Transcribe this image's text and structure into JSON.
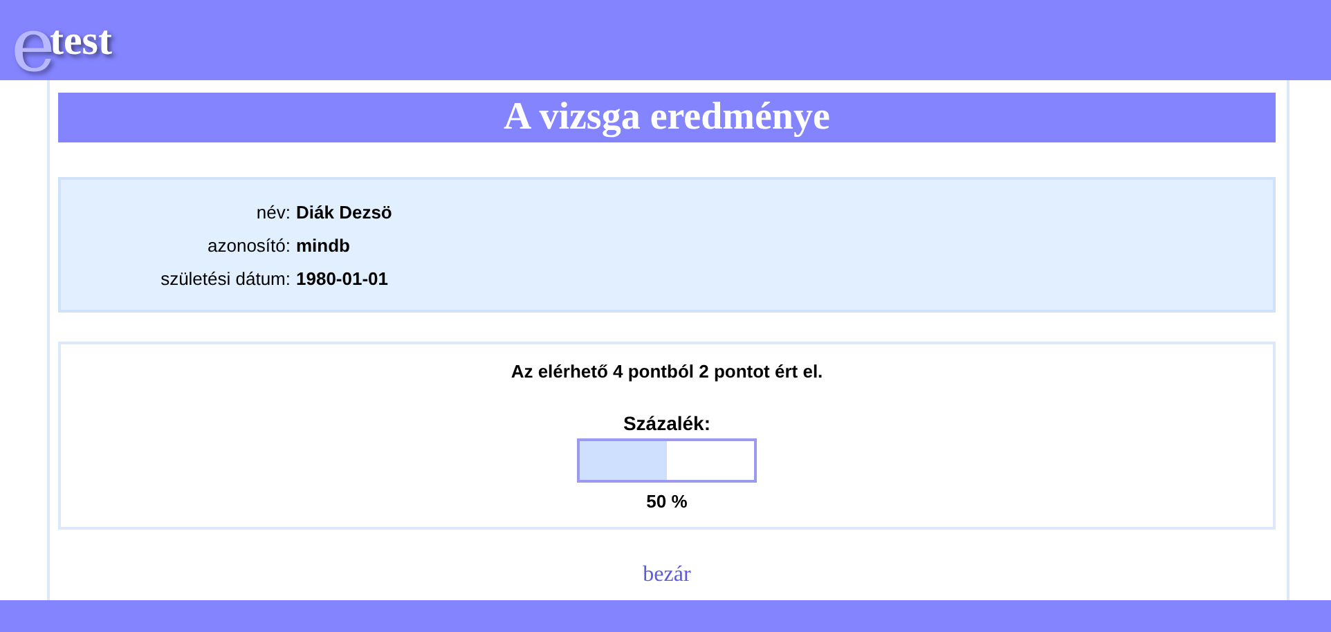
{
  "logo": {
    "mark": "e",
    "name": "test"
  },
  "title": "A vizsga eredménye",
  "student": [
    {
      "label": "név:",
      "value": "Diák Dezsö"
    },
    {
      "label": "azonosító:",
      "value": "mindb"
    },
    {
      "label": "születési dátum:",
      "value": "1980-01-01"
    }
  ],
  "result": {
    "summary": "Az elérhető 4 pontból 2 pontot ért el.",
    "percent_label": "Százalék:",
    "level": 0.5,
    "reading": "50 %"
  },
  "close_link": "bezár"
}
